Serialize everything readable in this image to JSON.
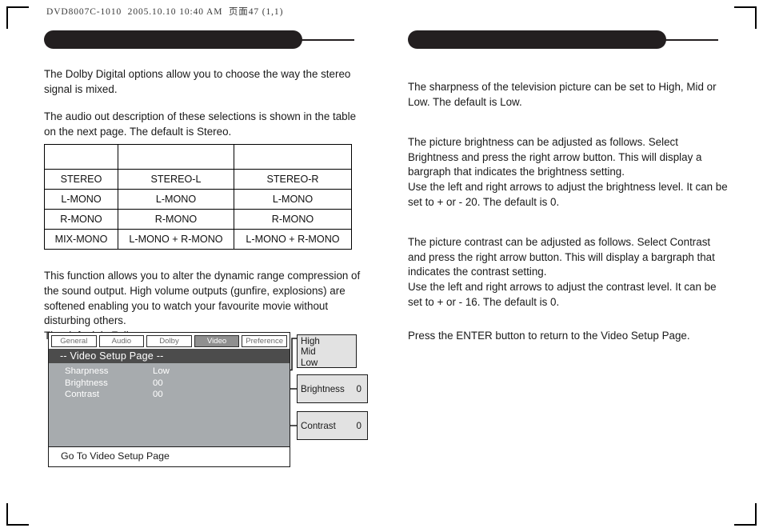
{
  "page": {
    "running_head": "DVD8007C-1010  2005.10.10 10:40 AM  页面47 (1,1)"
  },
  "left_column": {
    "section_heading": "",
    "paragraphs": [
      "The Dolby Digital options allow you to choose the way the stereo signal is mixed.",
      "The audio out description of these selections is shown in the table on the next page. The default is Stereo.",
      "This function allows you to alter the dynamic range compression of the sound output. High volume outputs (gunfire, explosions) are softened enabling you to watch your favourite movie without disturbing others.",
      "The default is Full."
    ],
    "audio_table": {
      "headers": [
        "",
        "",
        ""
      ],
      "rows": [
        [
          "STEREO",
          "STEREO-L",
          "STEREO-R"
        ],
        [
          "L-MONO",
          "L-MONO",
          "L-MONO"
        ],
        [
          "R-MONO",
          "R-MONO",
          "R-MONO"
        ],
        [
          "MIX-MONO",
          "L-MONO + R-MONO",
          "L-MONO + R-MONO"
        ]
      ]
    }
  },
  "right_column": {
    "section_heading": "",
    "paragraphs": [
      "The sharpness of the television picture can be set to High, Mid or Low. The default is Low.",
      "The picture brightness can be adjusted as follows. Select Brightness and press the right arrow button. This will display a bargraph that indicates the brightness setting.",
      "Use the left and right arrows to adjust the brightness level. It can be set to + or - 20. The default is 0.",
      "The picture contrast can be adjusted as follows. Select Contrast and press the right arrow button. This will display a bargraph that indicates the contrast setting.",
      "Use the left and right arrows to adjust the contrast level. It can be set to + or - 16. The default is 0.",
      "Press the ENTER button to return to the Video Setup Page."
    ]
  },
  "osd": {
    "tabs": [
      {
        "label": "General",
        "selected": false
      },
      {
        "label": "Audio",
        "selected": false
      },
      {
        "label": "Dolby",
        "selected": false
      },
      {
        "label": "Video",
        "selected": true
      },
      {
        "label": "Preference",
        "selected": false
      }
    ],
    "title": "-- Video Setup Page --",
    "rows": [
      {
        "label": "Sharpness",
        "value": "Low"
      },
      {
        "label": "Brightness",
        "value": "00"
      },
      {
        "label": "Contrast",
        "value": "00"
      }
    ],
    "footer": "Go To Video Setup Page",
    "callouts": {
      "sharpness_options": [
        "High",
        "Mid",
        "Low"
      ],
      "brightness": {
        "label": "Brightness",
        "value": "0"
      },
      "contrast": {
        "label": "Contrast",
        "value": "0"
      }
    }
  },
  "colors": {
    "ink": "#231f20",
    "osd_title_bg": "#4c4c4c",
    "osd_body_bg": "#a7abae",
    "osd_tab_selected_bg": "#8f8f8f",
    "callout_bg": "#e2e2e2"
  }
}
